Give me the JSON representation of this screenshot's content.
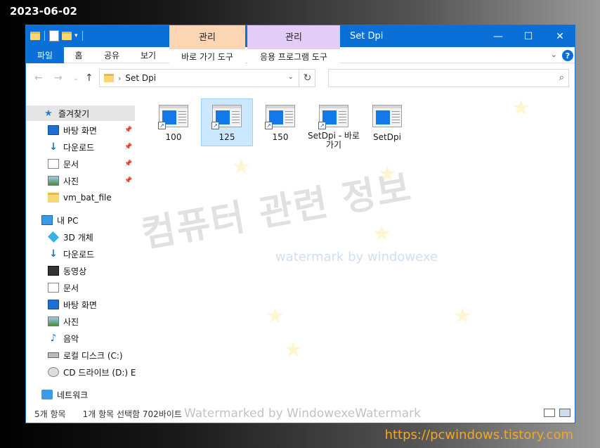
{
  "overlay": {
    "date": "2023-06-02",
    "site_url": "https://pcwindows.tistory.com"
  },
  "titlebar": {
    "ctx_tab_manage_1": "관리",
    "ctx_tab_manage_2": "관리",
    "title": "Set Dpi",
    "minimize": "—",
    "maximize": "☐",
    "close": "✕"
  },
  "ribbon": {
    "tabs": [
      "파일",
      "홈",
      "공유",
      "보기",
      "바로 가기 도구",
      "응용 프로그램 도구"
    ],
    "help": "?"
  },
  "address": {
    "path": "Set Dpi",
    "search_placeholder": ""
  },
  "nav": {
    "quick_access": "즐겨찾기",
    "quick_items": [
      "바탕 화면",
      "다운로드",
      "문서",
      "사진",
      "vm_bat_file"
    ],
    "this_pc": "내 PC",
    "pc_items": [
      "3D 개체",
      "다운로드",
      "동영상",
      "문서",
      "바탕 화면",
      "사진",
      "음악",
      "로컬 디스크 (C:)",
      "CD 드라이브 (D:) E"
    ],
    "network": "네트워크"
  },
  "files": [
    {
      "label": "100",
      "selected": false
    },
    {
      "label": "125",
      "selected": true
    },
    {
      "label": "150",
      "selected": false
    },
    {
      "label": "SetDpi - 바로 가기",
      "selected": false
    },
    {
      "label": "SetDpi",
      "selected": false
    }
  ],
  "status": {
    "count": "5개 항목",
    "selection": "1개 항목 선택함 702바이트"
  },
  "watermarks": {
    "korean": "컴퓨터 관련 정보",
    "english": "watermark by windowexe",
    "bottom": "Watermarked by WindowexeWatermark"
  }
}
